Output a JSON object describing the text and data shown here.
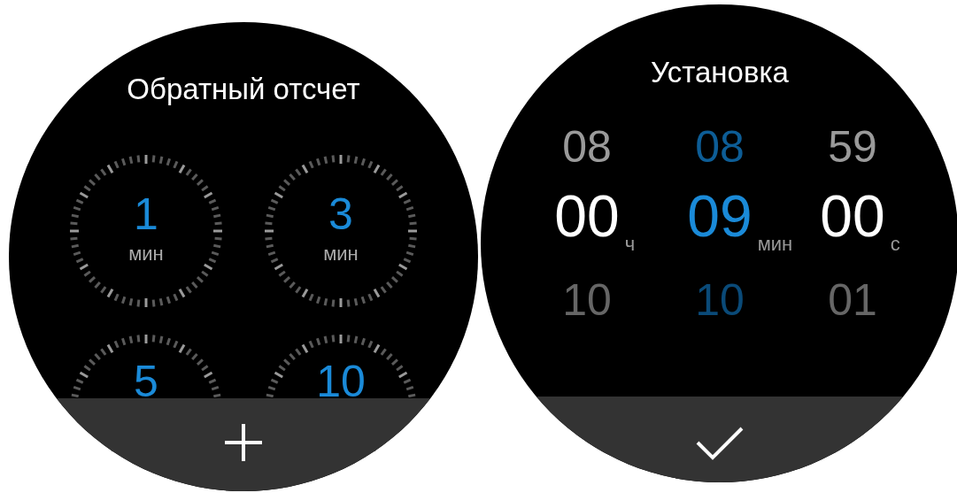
{
  "countdown_screen": {
    "title": "Обратный отсчет",
    "presets": [
      {
        "value": "1",
        "unit": "мин"
      },
      {
        "value": "3",
        "unit": "мин"
      },
      {
        "value": "5"
      },
      {
        "value": "10"
      }
    ]
  },
  "setup_screen": {
    "title": "Установка",
    "columns": [
      {
        "above": "08",
        "value": "00",
        "below": "10",
        "unit": "ч",
        "selected": false
      },
      {
        "above": "08",
        "value": "09",
        "below": "10",
        "unit": "мин",
        "selected": true
      },
      {
        "above": "59",
        "value": "00",
        "below": "01",
        "unit": "с",
        "selected": false
      }
    ]
  }
}
